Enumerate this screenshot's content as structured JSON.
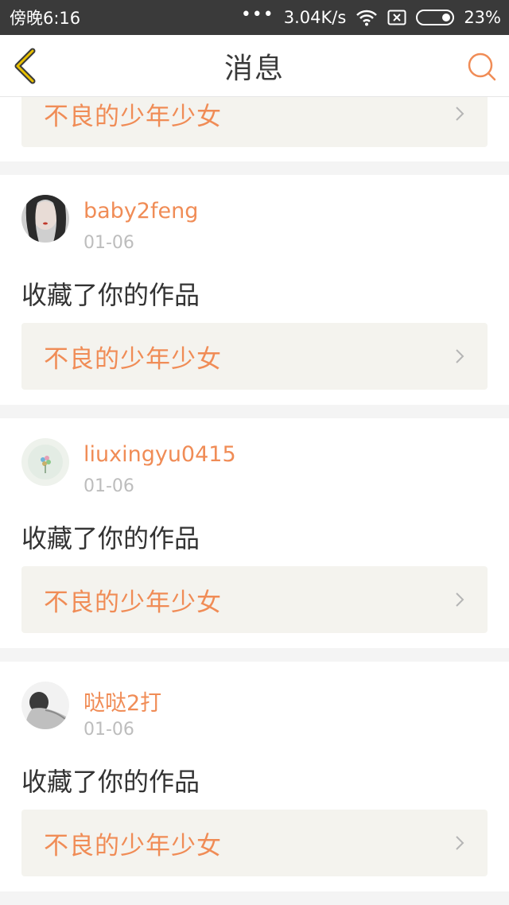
{
  "status_bar": {
    "time": "傍晚6:16",
    "dots": "•••",
    "network_speed": "3.04K/s",
    "battery": "23%"
  },
  "header": {
    "title": "消息",
    "back_icon": "chevron-left-icon",
    "search_icon": "search-icon"
  },
  "colors": {
    "accent": "#f08c56",
    "card_bg": "#f4f3ee",
    "page_bg": "#f4f4f4"
  },
  "partial_item": {
    "work_title": "不良的少年少女"
  },
  "messages": [
    {
      "username": "baby2feng",
      "date": "01-06",
      "action": "收藏了你的作品",
      "work_title": "不良的少年少女"
    },
    {
      "username": "liuxingyu0415",
      "date": "01-06",
      "action": "收藏了你的作品",
      "work_title": "不良的少年少女"
    },
    {
      "username": "哒哒2打",
      "date": "01-06",
      "action": "收藏了你的作品",
      "work_title": "不良的少年少女"
    }
  ]
}
